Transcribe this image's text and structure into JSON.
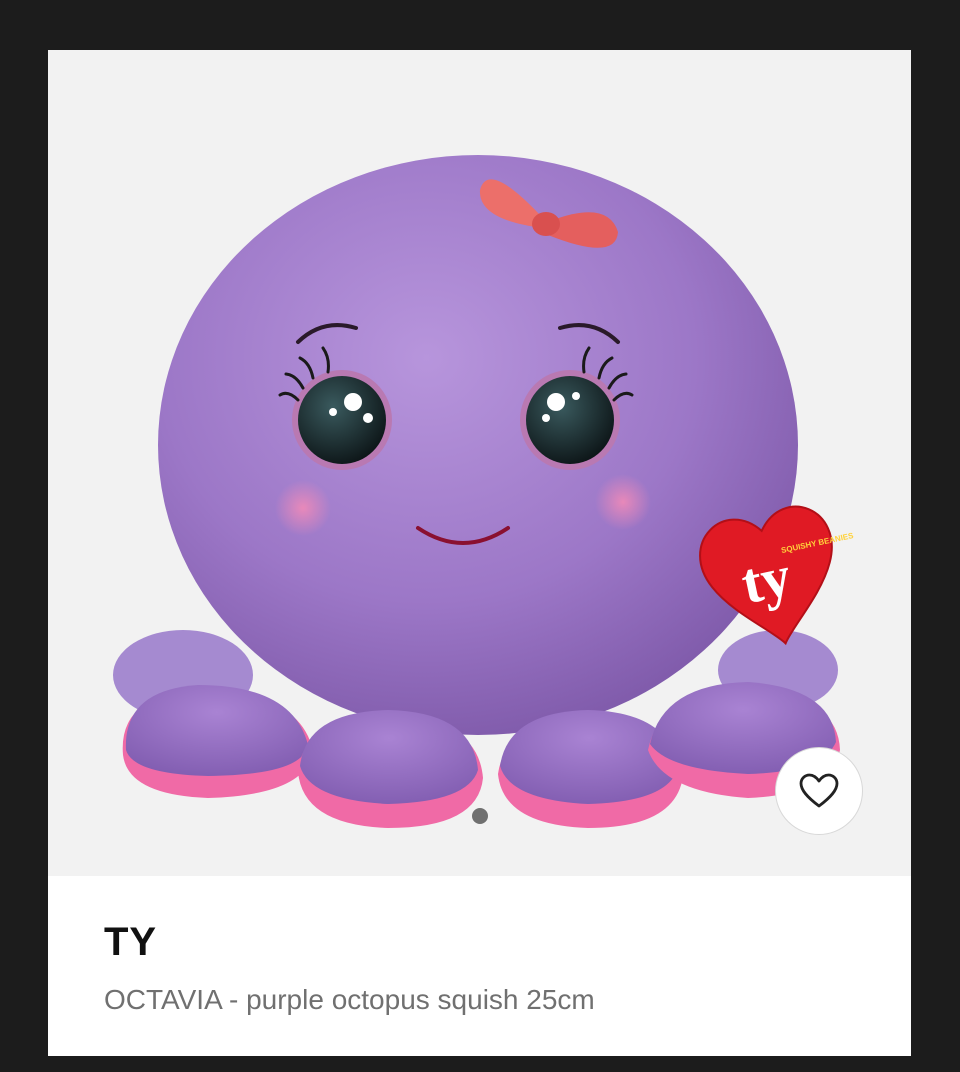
{
  "product": {
    "brand": "TY",
    "title": "OCTAVIA - purple octopus squish 25cm",
    "tag_text": "ty",
    "tag_subtext": "SQUISHY BEANIES",
    "image_subject": "purple-octopus-plush"
  },
  "carousel": {
    "slide_count": 1,
    "active_index": 0
  },
  "favorite": {
    "icon": "heart-icon",
    "selected": false
  },
  "colors": {
    "page_background": "#1c1c1c",
    "image_background": "#f2f2f2",
    "card_background": "#ffffff",
    "brand_text": "#111111",
    "title_text": "#707070",
    "plush_purple": "#9a74c4",
    "plush_pink": "#f06aa6",
    "tag_red": "#e01a24"
  }
}
